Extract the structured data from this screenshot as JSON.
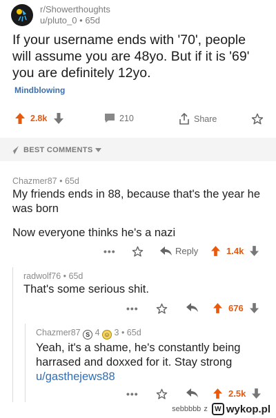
{
  "post": {
    "subreddit": "r/Showerthoughts",
    "author": "u/pluto_0",
    "age": "65d",
    "separator": "•",
    "title": "If your username ends with '70', people will assume you are 48yo. But if it is '69' you are definitely 12yo.",
    "flair": "Mindblowing",
    "votes": "2.8k",
    "comments": "210",
    "share_label": "Share"
  },
  "sort_bar": {
    "label": "BEST COMMENTS"
  },
  "comments": [
    {
      "author": "Chazmer87",
      "age": "65d",
      "body_line1": "My friends ends in 88, because that's the year he was born",
      "body_line2": "Now everyone thinks he's a nazi",
      "reply_label": "Reply",
      "votes": "1.4k"
    },
    {
      "author": "radwolf76",
      "age": "65d",
      "body": "That's some serious shit.",
      "votes": "676"
    },
    {
      "author": "Chazmer87",
      "silver_count": "4",
      "gold_count": "3",
      "age": "65d",
      "body": "Yeah, it's a shame, he's constantly being harrased and doxxed for it.  Stay strong ",
      "link": "u/gasthejews88",
      "votes": "2.5k"
    }
  ],
  "footer": {
    "uploader": "sebbbbb",
    "z": "z",
    "site": "wykop.pl"
  },
  "colors": {
    "accent": "#e8590c",
    "link": "#2d6fb7",
    "flair": "#3f6fa8"
  },
  "icons": [
    "subreddit-icon",
    "upvote-icon",
    "downvote-icon",
    "comment-icon",
    "share-icon",
    "star-icon",
    "rocket-icon",
    "caret-down-icon",
    "reply-icon",
    "silver-award-icon",
    "gold-award-icon",
    "wykop-logo"
  ]
}
